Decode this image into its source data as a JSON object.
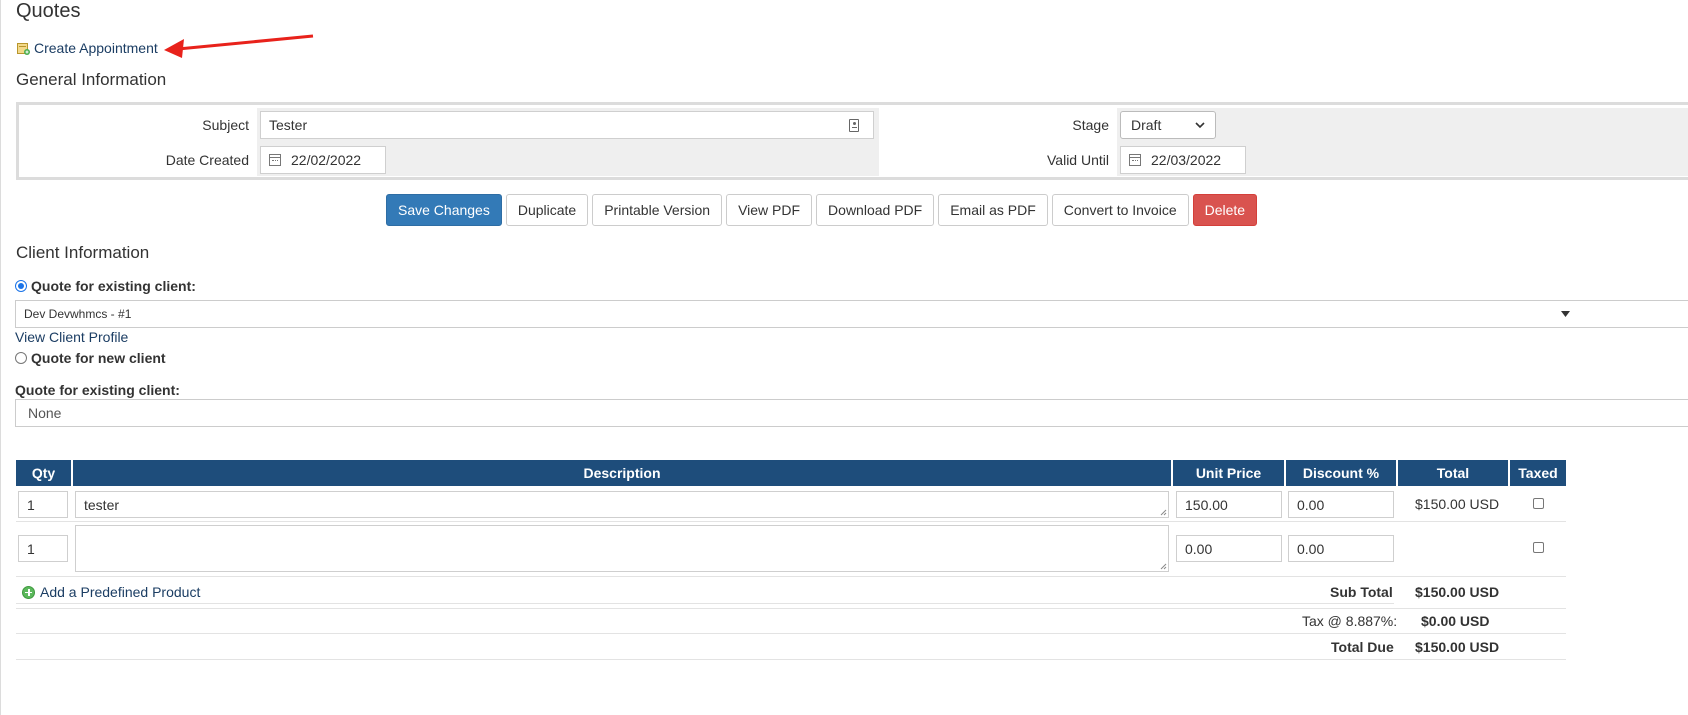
{
  "page": {
    "title": "Quotes"
  },
  "actions": {
    "create_appointment": "Create Appointment"
  },
  "general": {
    "title": "General Information",
    "subject_label": "Subject",
    "subject_value": "Tester",
    "date_created_label": "Date Created",
    "date_created_value": "22/02/2022",
    "stage_label": "Stage",
    "stage_value": "Draft",
    "valid_until_label": "Valid Until",
    "valid_until_value": "22/03/2022"
  },
  "buttons": {
    "save": "Save Changes",
    "duplicate": "Duplicate",
    "printable": "Printable Version",
    "view_pdf": "View PDF",
    "download_pdf": "Download PDF",
    "email_pdf": "Email as PDF",
    "convert": "Convert to Invoice",
    "delete": "Delete"
  },
  "client": {
    "title": "Client Information",
    "existing_label": "Quote for existing client:",
    "existing_value": "Dev Devwhmcs - #1",
    "view_profile": "View Client Profile",
    "new_label": "Quote for new client",
    "second_label": "Quote for existing client:",
    "second_value": "None"
  },
  "table": {
    "headers": [
      "Qty",
      "Description",
      "Unit Price",
      "Discount %",
      "Total",
      "Taxed"
    ],
    "rows": [
      {
        "qty": "1",
        "description": "tester",
        "unit_price": "150.00",
        "discount": "0.00",
        "total": "$150.00 USD"
      },
      {
        "qty": "1",
        "description": "",
        "unit_price": "0.00",
        "discount": "0.00",
        "total": ""
      }
    ],
    "add_product": "Add a Predefined Product",
    "subtotal_label": "Sub Total",
    "subtotal_value": "$150.00 USD",
    "tax_label": "Tax @ 8.887%:",
    "tax_value": "$0.00 USD",
    "total_due_label": "Total Due",
    "total_due_value": "$150.00 USD"
  },
  "colors": {
    "header_bg": "#1e4d7b",
    "primary": "#337ab7",
    "danger": "#d9534f",
    "link": "#1b3d63",
    "arrow": "#e8221b"
  }
}
